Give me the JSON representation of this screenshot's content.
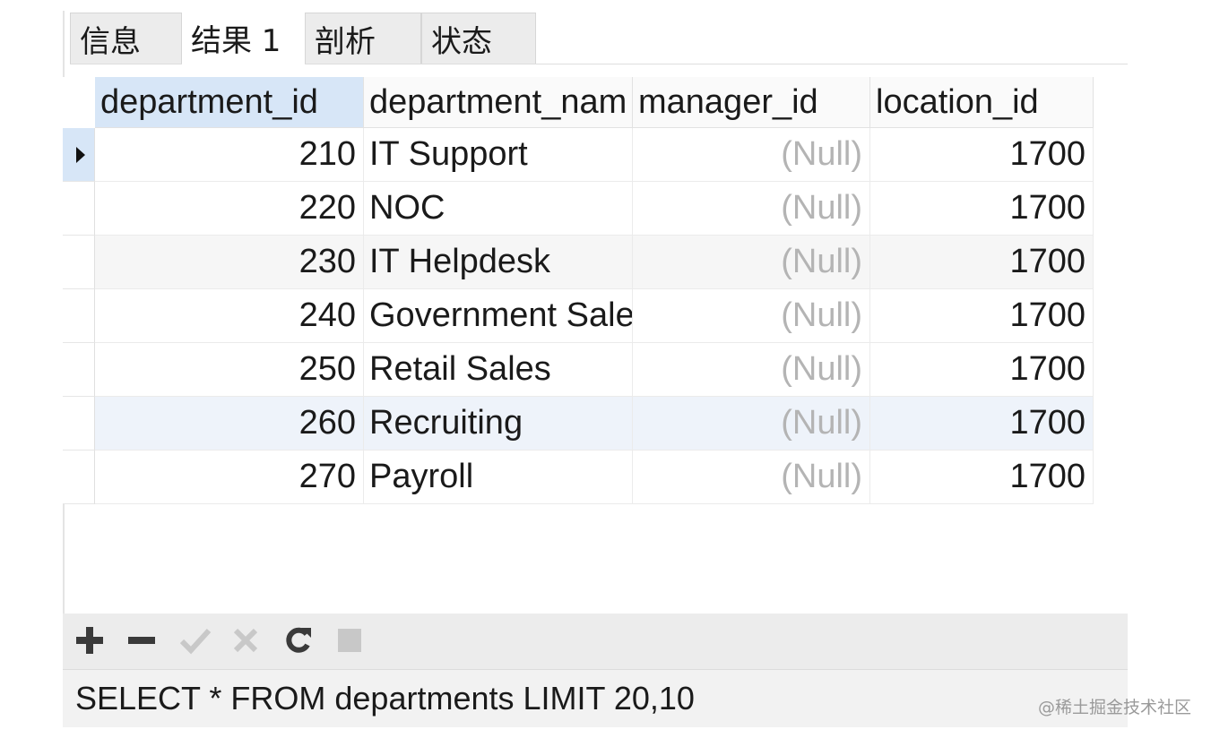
{
  "tabs": [
    {
      "label": "信息",
      "active": false
    },
    {
      "label": "结果 1",
      "active": true
    },
    {
      "label": "剖析",
      "active": false
    },
    {
      "label": "状态",
      "active": false
    }
  ],
  "grid": {
    "columns": [
      "department_id",
      "department_nam",
      "manager_id",
      "location_id"
    ],
    "rows": [
      {
        "department_id": "210",
        "department_name": "IT Support",
        "manager_id": "(Null)",
        "location_id": "1700"
      },
      {
        "department_id": "220",
        "department_name": "NOC",
        "manager_id": "(Null)",
        "location_id": "1700"
      },
      {
        "department_id": "230",
        "department_name": "IT Helpdesk",
        "manager_id": "(Null)",
        "location_id": "1700"
      },
      {
        "department_id": "240",
        "department_name": "Government Sales",
        "manager_id": "(Null)",
        "location_id": "1700"
      },
      {
        "department_id": "250",
        "department_name": "Retail Sales",
        "manager_id": "(Null)",
        "location_id": "1700"
      },
      {
        "department_id": "260",
        "department_name": "Recruiting",
        "manager_id": "(Null)",
        "location_id": "1700"
      },
      {
        "department_id": "270",
        "department_name": "Payroll",
        "manager_id": "(Null)",
        "location_id": "1700"
      }
    ],
    "current_row": 0
  },
  "toolbar": {
    "icons": [
      "plus-icon",
      "minus-icon",
      "check-icon",
      "cross-icon",
      "refresh-icon",
      "stop-icon"
    ],
    "enabled_color": "#3a3a3a",
    "disabled_color": "#c8c8c8"
  },
  "status": {
    "query": "SELECT * FROM departments LIMIT 20,10"
  },
  "watermark": "@稀土掘金技术社区"
}
